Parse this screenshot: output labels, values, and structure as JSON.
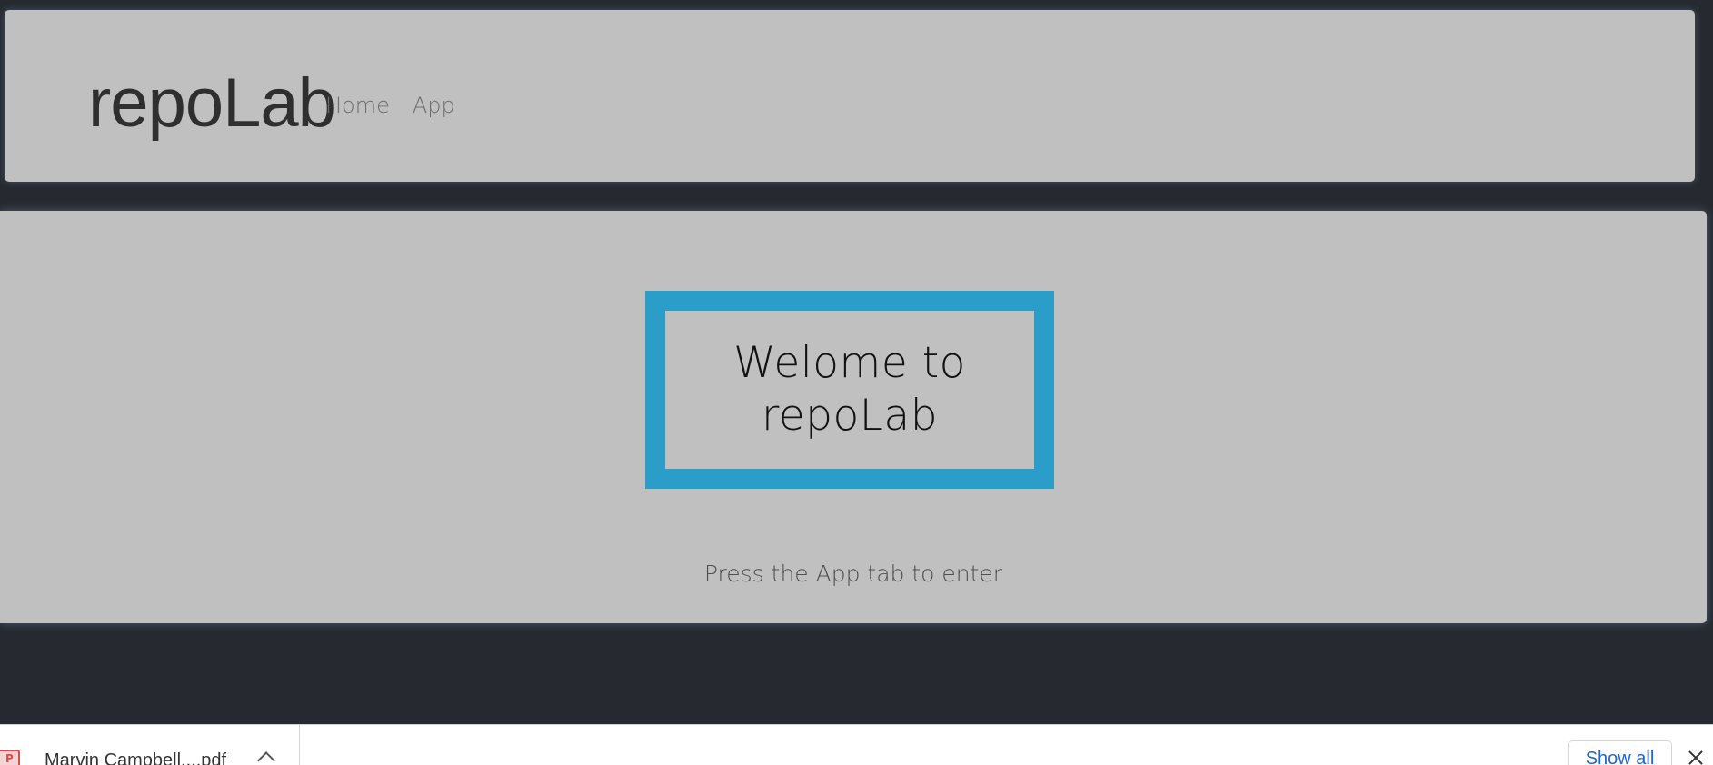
{
  "header": {
    "brand": "repoLab",
    "nav": [
      {
        "label": "Home"
      },
      {
        "label": "App"
      }
    ]
  },
  "main": {
    "welcome_title": "Welome to repoLab",
    "subtitle": "Press the App tab to enter"
  },
  "download_bar": {
    "file_name": "Marvin Campbell....pdf",
    "file_icon": "pdf-icon",
    "show_all_label": "Show all",
    "close_icon": "close-icon"
  },
  "colors": {
    "page_background": "#262a30",
    "panel_background": "#c0c0c0",
    "accent_border": "#2a9ec8",
    "download_bar_background": "#ffffff",
    "link_blue": "#1f67c8"
  }
}
